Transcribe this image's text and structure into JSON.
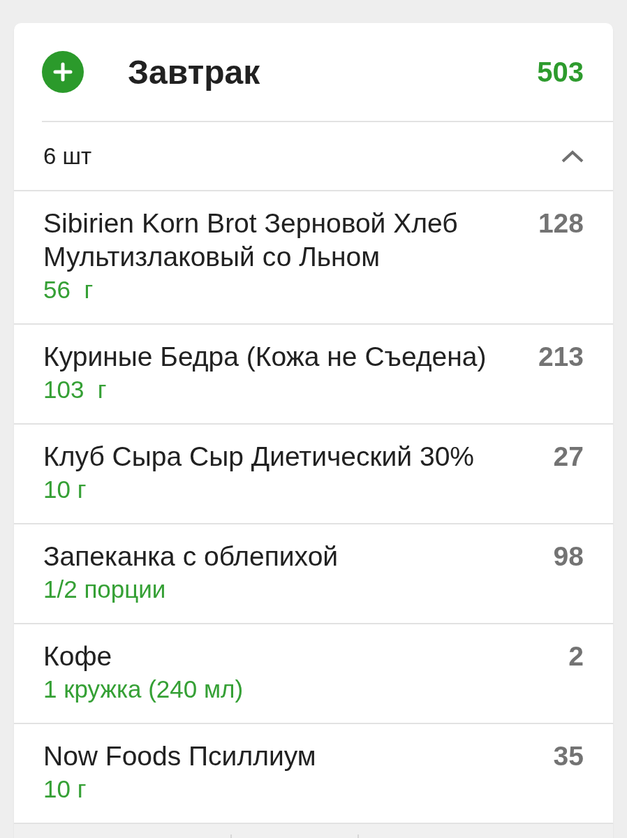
{
  "meal": {
    "title": "Завтрак",
    "calories": "503"
  },
  "summary": {
    "count": "6 шт",
    "expanded": true
  },
  "items": [
    {
      "name": "Sibirien Korn Brot Зерновой Хлеб Мультизлаковый со Льном",
      "amount": "56  г",
      "calories": "128"
    },
    {
      "name": "Куриные Бедра (Кожа не Съедена)",
      "amount": "103  г",
      "calories": "213"
    },
    {
      "name": "Клуб Сыра Сыр Диетический 30%",
      "amount": "10 г",
      "calories": "27"
    },
    {
      "name": "Запеканка с облепихой",
      "amount": "1/2 порции",
      "calories": "98"
    },
    {
      "name": "Кофе",
      "amount": "1 кружка (240 мл)",
      "calories": "2"
    },
    {
      "name": "Now Foods Псиллиум",
      "amount": "10 г",
      "calories": "35"
    }
  ]
}
